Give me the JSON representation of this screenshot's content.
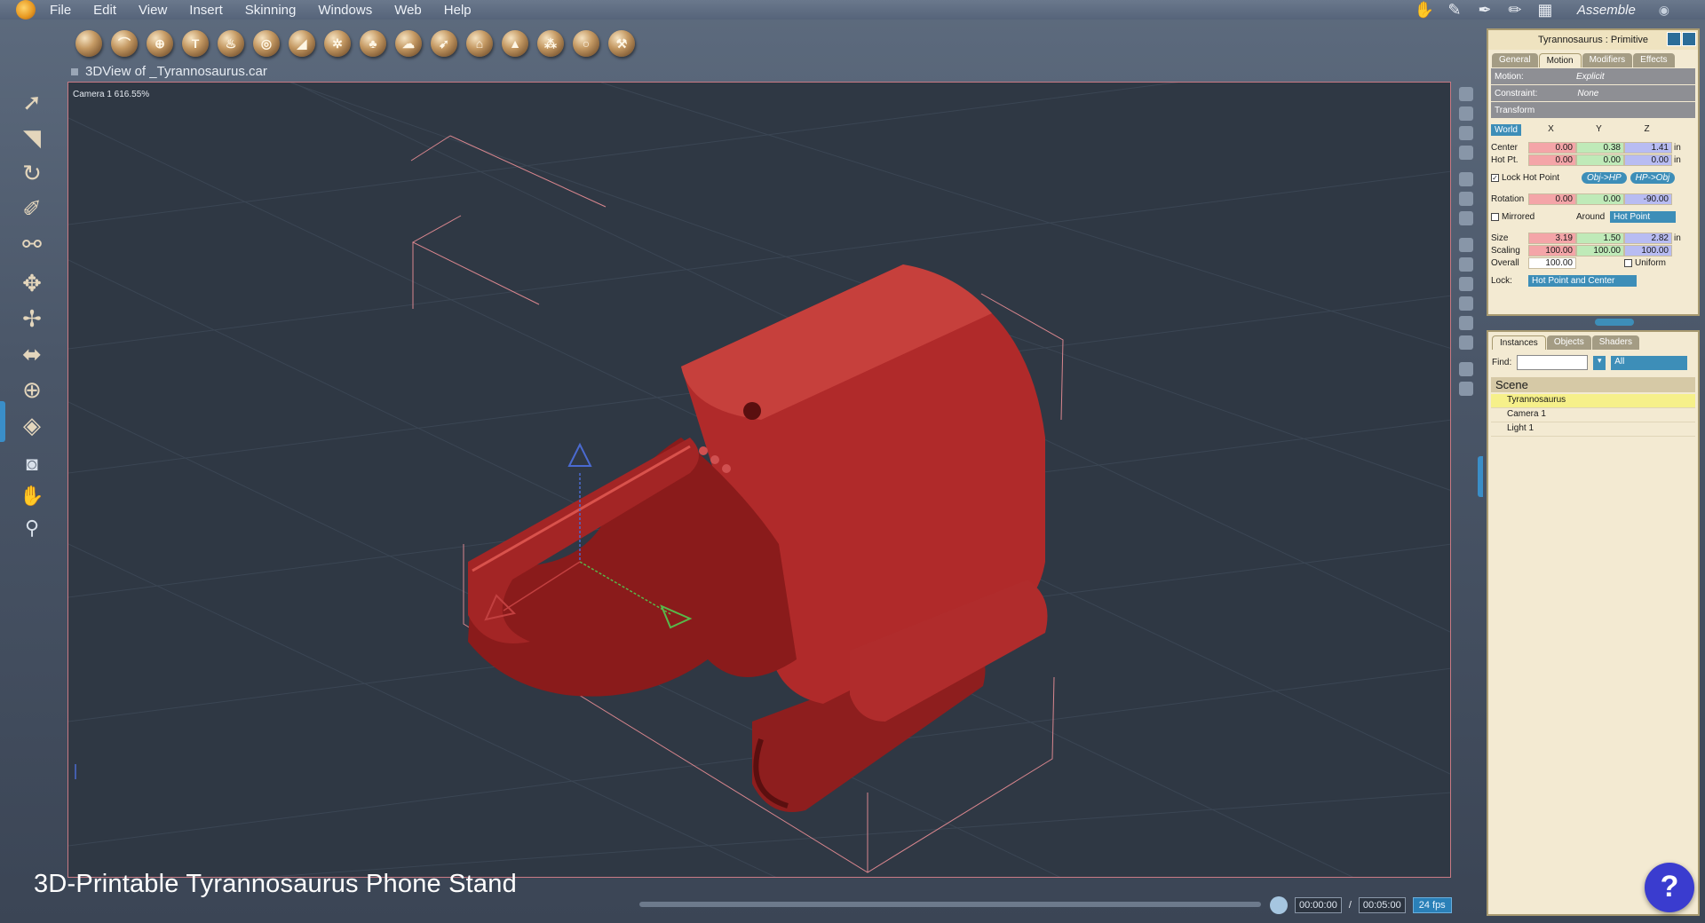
{
  "menu": {
    "items": [
      "File",
      "Edit",
      "View",
      "Insert",
      "Skinning",
      "Windows",
      "Web",
      "Help"
    ],
    "mode_label": "Assemble"
  },
  "viewport": {
    "title": "3DView of _Tyrannosaurus.car",
    "camera_label": "Camera 1 616.55%",
    "model_color": "#a52a2a",
    "background_color": "#2f3844"
  },
  "caption": "3D-Printable Tyrannosaurus Phone Stand",
  "timeline": {
    "current_time": "00:00:00",
    "separator": "/",
    "end_time": "00:05:00",
    "fps": "24 fps"
  },
  "properties": {
    "title": "Tyrannosaurus : Primitive",
    "tabs": [
      "General",
      "Motion",
      "Modifiers",
      "Effects"
    ],
    "active_tab": "Motion",
    "motion_label": "Motion:",
    "motion_value": "Explicit",
    "constraint_label": "Constraint:",
    "constraint_value": "None",
    "transform_label": "Transform",
    "space_select": "World",
    "col_x": "X",
    "col_y": "Y",
    "col_z": "Z",
    "center": {
      "label": "Center",
      "x": "0.00",
      "y": "0.38",
      "z": "1.41",
      "unit": "in"
    },
    "hot_pt": {
      "label": "Hot Pt.",
      "x": "0.00",
      "y": "0.00",
      "z": "0.00",
      "unit": "in"
    },
    "lock_hot_point": "Lock Hot Point",
    "obj_hp_btn": "Obj->HP",
    "hp_obj_btn": "HP->Obj",
    "rotation": {
      "label": "Rotation",
      "x": "0.00",
      "y": "0.00",
      "z": "-90.00"
    },
    "mirrored": "Mirrored",
    "around_label": "Around",
    "around_value": "Hot Point",
    "size": {
      "label": "Size",
      "x": "3.19",
      "y": "1.50",
      "z": "2.82",
      "unit": "in"
    },
    "scaling": {
      "label": "Scaling",
      "x": "100.00",
      "y": "100.00",
      "z": "100.00"
    },
    "overall": {
      "label": "Overall",
      "value": "100.00"
    },
    "uniform": "Uniform",
    "lock_label": "Lock:",
    "lock_value": "Hot Point and Center"
  },
  "instances": {
    "tabs": [
      "Instances",
      "Objects",
      "Shaders"
    ],
    "active_tab": "Instances",
    "find_label": "Find:",
    "filter_value": "All",
    "scene_label": "Scene",
    "items": [
      "Tyrannosaurus",
      "Camera 1",
      "Light 1"
    ],
    "selected": "Tyrannosaurus"
  }
}
